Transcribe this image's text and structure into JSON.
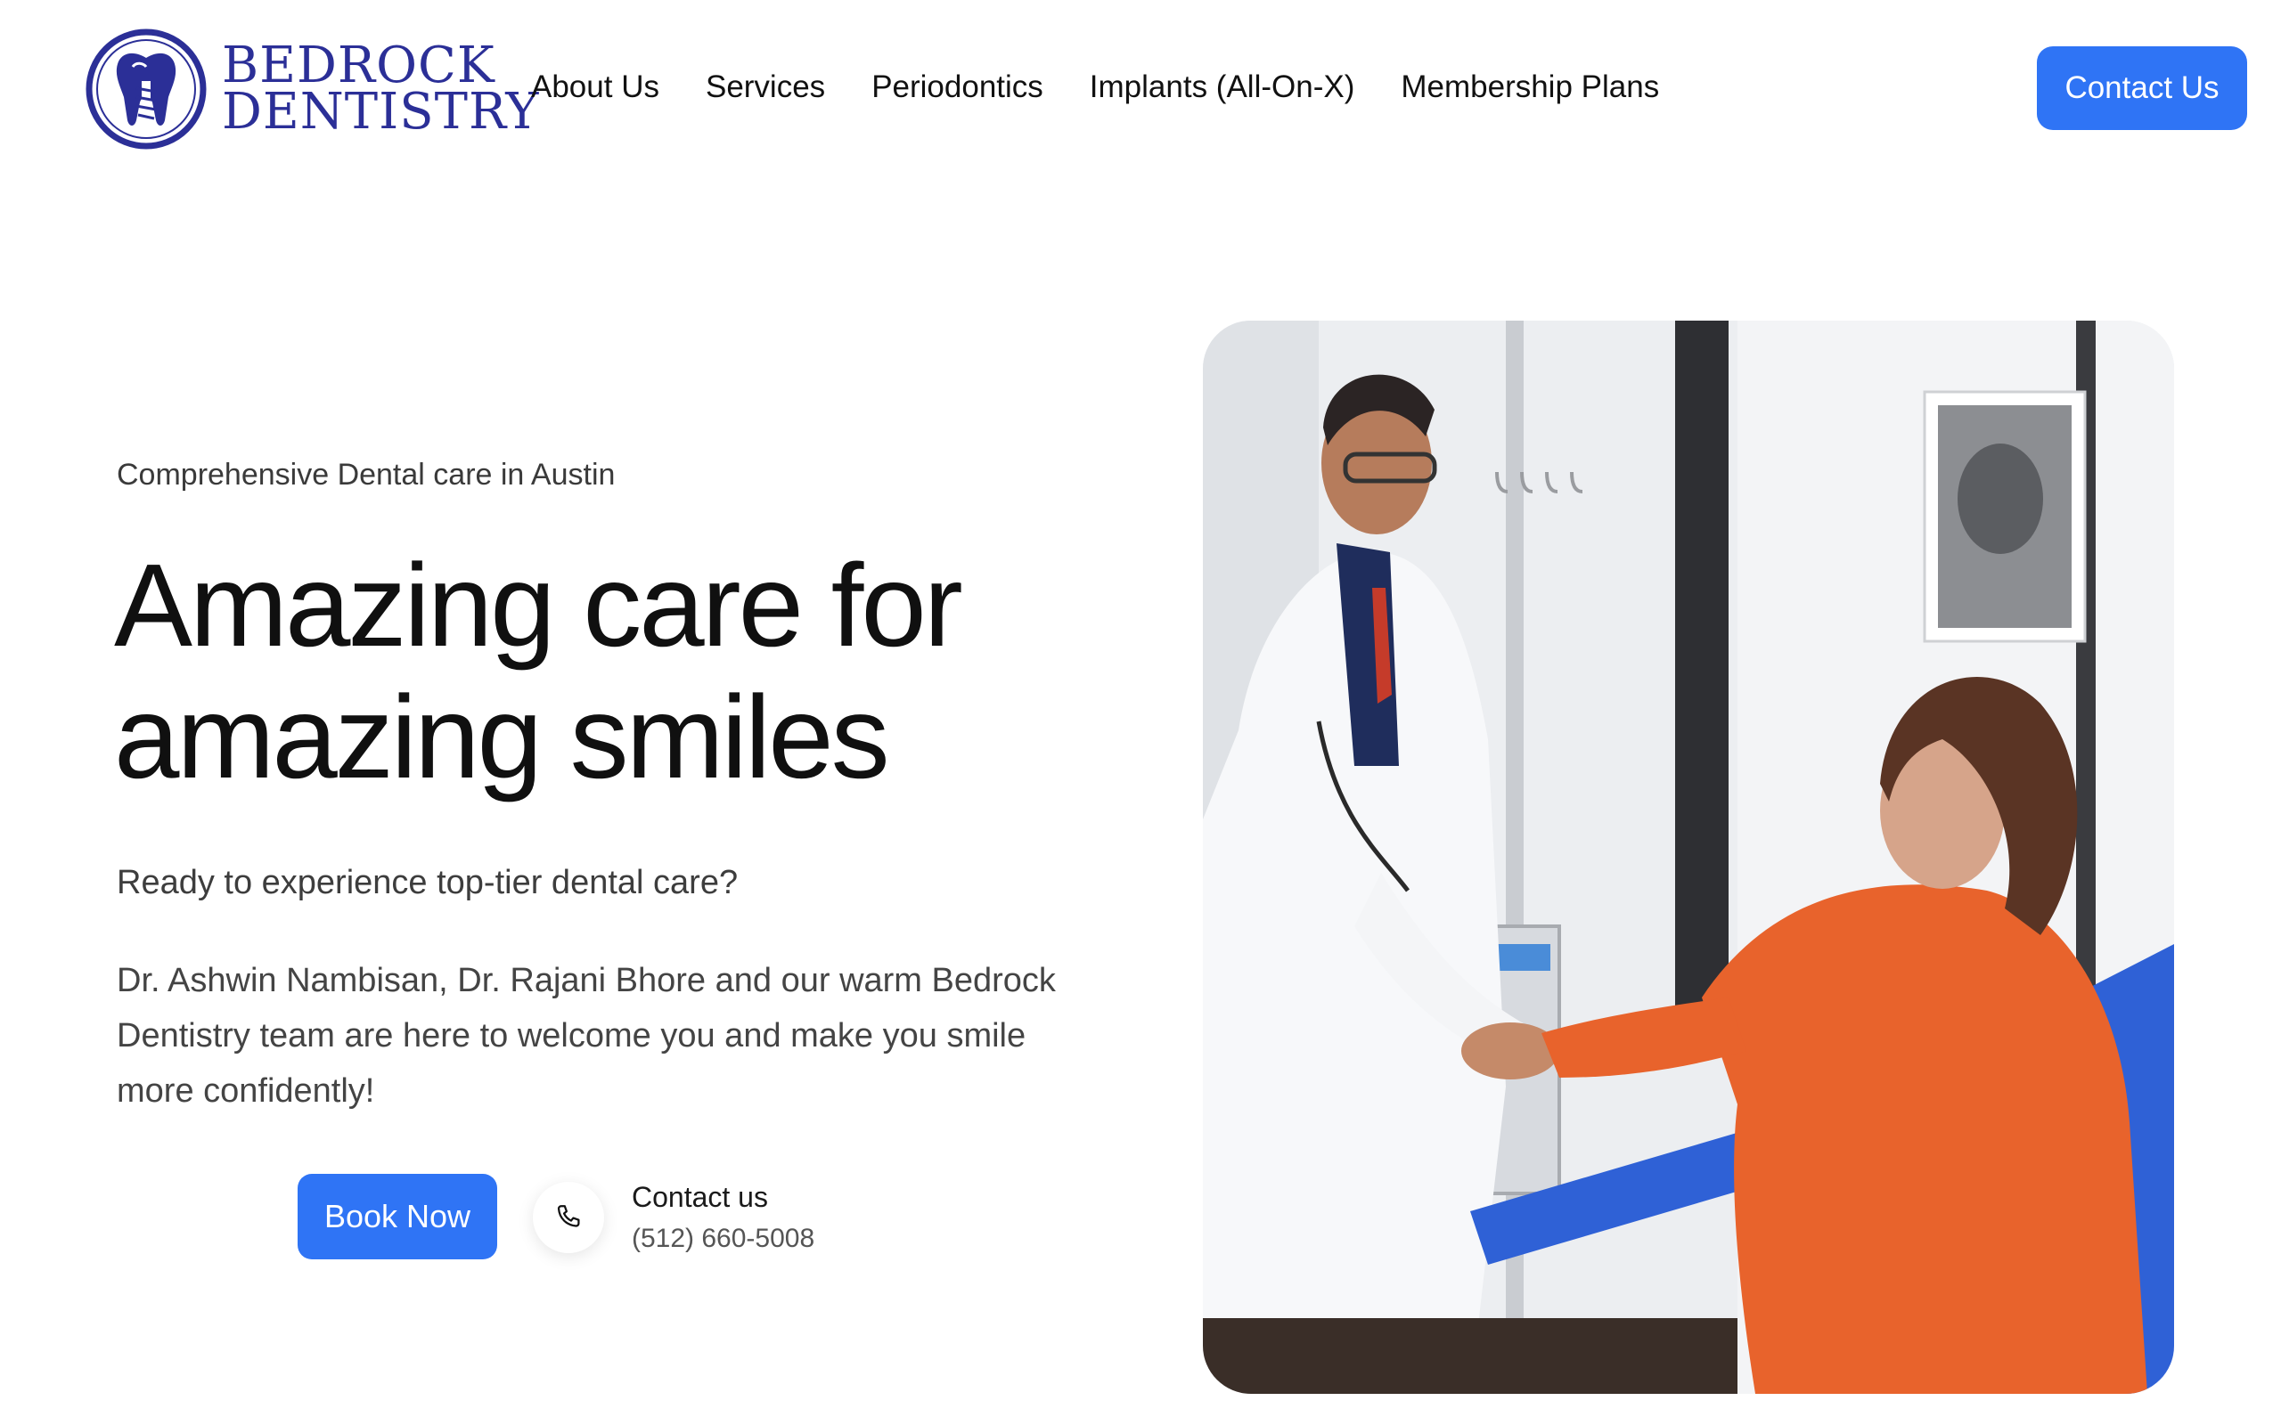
{
  "brand": {
    "line1": "BEDROCK",
    "line2": "DENTISTRY",
    "color": "#2b2f97"
  },
  "nav": {
    "items": [
      "About Us",
      "Services",
      "Periodontics",
      "Implants (All-On-X)",
      "Membership Plans"
    ],
    "cta_label": "Contact Us"
  },
  "hero": {
    "eyebrow": "Comprehensive Dental care in Austin",
    "headline_line1": "Amazing care for",
    "headline_line2": "amazing smiles",
    "lead": "Ready to experience top-tier dental care?",
    "body": "Dr. Ashwin Nambisan, Dr. Rajani Bhore and our warm Bedrock Dentistry team are here to welcome you and make you smile more confidently!",
    "book_label": "Book Now",
    "contact_label": "Contact us",
    "contact_phone": "(512) 660-5008",
    "phone_icon": "phone-icon",
    "image_subject": "dentist-shaking-hands-with-patient"
  },
  "colors": {
    "accent": "#2f74f5",
    "text": "#121212"
  }
}
